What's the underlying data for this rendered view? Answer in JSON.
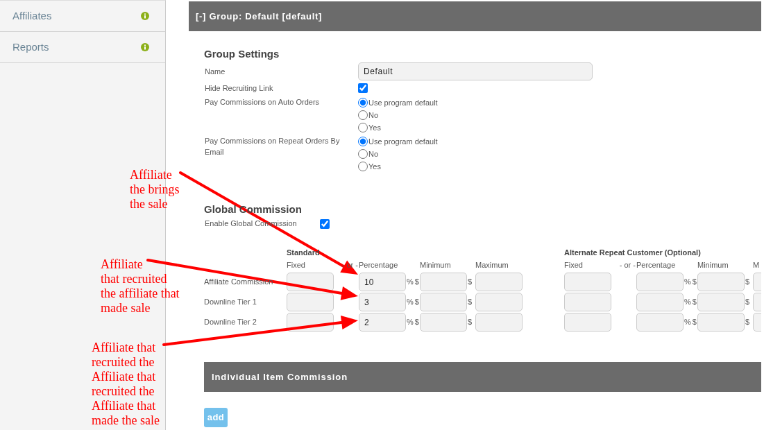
{
  "sidebar": {
    "items": [
      {
        "label": "Affiliates"
      },
      {
        "label": "Reports"
      }
    ]
  },
  "group_panel": {
    "title": "[-] Group: Default [default]",
    "group_settings": {
      "heading": "Group Settings",
      "fields": [
        {
          "kind": "text",
          "label": "Name",
          "value": "Default"
        },
        {
          "kind": "checkbox",
          "label": "Hide Recruiting Link",
          "checked": true
        },
        {
          "kind": "radio",
          "label": "Pay Commissions on Auto Orders",
          "options": [
            {
              "label": "Use program default",
              "selected": true
            },
            {
              "label": "No",
              "selected": false
            },
            {
              "label": "Yes",
              "selected": false
            }
          ]
        },
        {
          "kind": "radio",
          "label": "Pay Commissions on Repeat Orders By Email",
          "options": [
            {
              "label": "Use program default",
              "selected": true
            },
            {
              "label": "No",
              "selected": false
            },
            {
              "label": "Yes",
              "selected": false
            }
          ]
        }
      ]
    },
    "global_commission": {
      "heading": "Global Commission",
      "enable": {
        "label": "Enable Global Commission",
        "checked": true
      },
      "groups": [
        {
          "title": "Standard",
          "columns": [
            "Fixed",
            "- or -",
            "Percentage",
            "Minimum",
            "Maximum"
          ]
        },
        {
          "title": "Alternate Repeat Customer (Optional)",
          "columns": [
            "Fixed",
            "- or -",
            "Percentage",
            "Minimum",
            "M"
          ]
        }
      ],
      "rows": [
        {
          "label": "Affiliate Commission",
          "cells": [
            {
              "percentage": "10",
              "percent_unit": "%",
              "minimum_unit": "$",
              "maximum_unit": "$"
            },
            {
              "percent_unit": "%",
              "minimum_unit": "$",
              "maximum_unit": "$"
            }
          ]
        },
        {
          "label": "Downline Tier 1",
          "cells": [
            {
              "percentage": "3",
              "percent_unit": "%",
              "minimum_unit": "$",
              "maximum_unit": "$"
            },
            {
              "percent_unit": "%",
              "minimum_unit": "$",
              "maximum_unit": "$"
            }
          ]
        },
        {
          "label": "Downline Tier 2",
          "cells": [
            {
              "percentage": "2",
              "percent_unit": "%",
              "minimum_unit": "$",
              "maximum_unit": "$"
            },
            {
              "percent_unit": "%",
              "minimum_unit": "$",
              "maximum_unit": "$"
            }
          ]
        }
      ]
    }
  },
  "item_commission": {
    "title": "Individual Item Commission",
    "add_button": "add"
  },
  "annotations": [
    {
      "text": "Affiliate\nthe brings\nthe sale"
    },
    {
      "text": "Affiliate\nthat recruited\nthe affiliate that\nmade sale"
    },
    {
      "text": "Affiliate that\nrecruited the\nAffiliate that\nrecruited the\nAffiliate that\nmade the sale"
    }
  ]
}
